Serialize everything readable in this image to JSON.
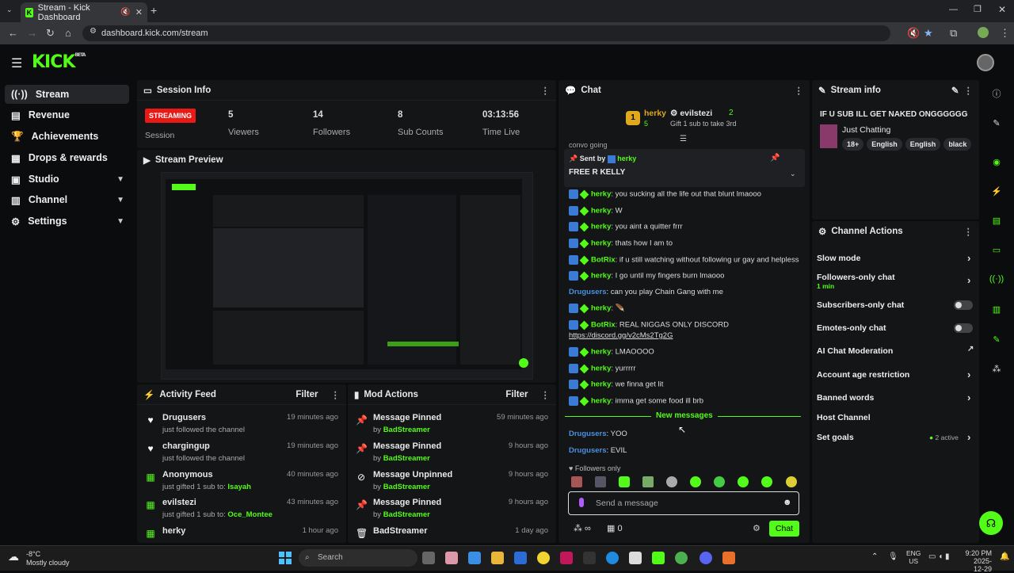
{
  "browser": {
    "tab_title": "Stream - Kick Dashboard",
    "url": "dashboard.kick.com/stream"
  },
  "app": {
    "logo": "KICK",
    "logo_sup": "BETA"
  },
  "sidebar": {
    "items": [
      {
        "label": "Stream",
        "icon": "broadcast-icon"
      },
      {
        "label": "Revenue",
        "icon": "money-icon"
      },
      {
        "label": "Achievements",
        "icon": "trophy-icon"
      },
      {
        "label": "Drops & rewards",
        "icon": "gift-icon"
      },
      {
        "label": "Studio",
        "icon": "studio-icon"
      },
      {
        "label": "Channel",
        "icon": "channel-icon"
      },
      {
        "label": "Settings",
        "icon": "gear-icon"
      }
    ]
  },
  "session": {
    "title": "Session Info",
    "status_badge": "STREAMING",
    "status_label": "Session",
    "viewers_value": "5",
    "viewers_label": "Viewers",
    "followers_value": "14",
    "followers_label": "Followers",
    "subs_value": "8",
    "subs_label": "Sub Counts",
    "time_value": "03:13:56",
    "time_label": "Time Live"
  },
  "preview": {
    "title": "Stream Preview"
  },
  "activity": {
    "title": "Activity Feed",
    "filter": "Filter",
    "rows": [
      {
        "name": "Drugusers",
        "desc": "just followed the channel",
        "extra": "",
        "time": "19 minutes ago"
      },
      {
        "name": "chargingup",
        "desc": "just followed the channel",
        "extra": "",
        "time": "19 minutes ago"
      },
      {
        "name": "Anonymous",
        "desc": "just gifted 1 sub to:",
        "extra": "Isayah",
        "time": "40 minutes ago"
      },
      {
        "name": "evilstezi",
        "desc": "just gifted 1 sub to:",
        "extra": "Oce_Montee",
        "time": "43 minutes ago"
      },
      {
        "name": "herky",
        "desc": "",
        "extra": "",
        "time": "1 hour ago"
      }
    ]
  },
  "mod": {
    "title": "Mod Actions",
    "filter": "Filter",
    "rows": [
      {
        "name": "Message Pinned",
        "by": "by",
        "who": "BadStreamer",
        "time": "59 minutes ago"
      },
      {
        "name": "Message Pinned",
        "by": "by",
        "who": "BadStreamer",
        "time": "9 hours ago"
      },
      {
        "name": "Message Unpinned",
        "by": "by",
        "who": "BadStreamer",
        "time": "9 hours ago"
      },
      {
        "name": "Message Pinned",
        "by": "by",
        "who": "BadStreamer",
        "time": "9 hours ago"
      },
      {
        "name": "BadStreamer",
        "by": "",
        "who": "",
        "time": "1 day ago"
      }
    ]
  },
  "chat": {
    "title": "Chat",
    "gifter1": "herky",
    "gifter1_count": "5",
    "gifter2": "evilstezi",
    "gifter2_count": "2",
    "gift_hint": "Gift 1 sub to take 3rd",
    "partial": "convo going",
    "pinned_by": "Sent by",
    "pinned_user": "herky",
    "pinned_text": "FREE R KELLY",
    "messages": [
      {
        "user": "herky",
        "text": "you sucking all the life out that blunt lmaooo"
      },
      {
        "user": "herky",
        "text": "W"
      },
      {
        "user": "herky",
        "text": "you aint a quitter frrr"
      },
      {
        "user": "herky",
        "text": "thats how I am to"
      },
      {
        "user": "BotRix",
        "text": "if u still watching without following ur gay and helpless"
      },
      {
        "user": "herky",
        "text": "I go until my fingers burn lmaooo"
      },
      {
        "user": "Drugusers",
        "text": "can you play Chain Gang with me"
      },
      {
        "user": "herky",
        "text": ""
      },
      {
        "user": "BotRix",
        "text": "REAL NIGGAS ONLY DISCORD"
      },
      {
        "user": "",
        "text": "https://discord.gg/v2cMs2Tg2G"
      },
      {
        "user": "herky",
        "text": "LMAOOOO"
      },
      {
        "user": "herky",
        "text": "yurrrrr"
      },
      {
        "user": "herky",
        "text": "we finna get lit"
      },
      {
        "user": "herky",
        "text": "imma get some food ill brb"
      }
    ],
    "new_messages": "New messages",
    "new": [
      {
        "user": "Drugusers",
        "text": "YOO"
      },
      {
        "user": "Drugusers",
        "text": "EVIL"
      }
    ],
    "followers_only": "Followers only",
    "placeholder": "Send a message",
    "points": "0",
    "send": "Chat"
  },
  "stream_info": {
    "title": "Stream info",
    "stream_title": "IF U SUB ILL GET NAKED ONGGGGGG",
    "category": "Just Chatting",
    "tags": [
      "18+",
      "English",
      "English",
      "black"
    ]
  },
  "channel_actions": {
    "title": "Channel Actions",
    "slow": "Slow mode",
    "followers": "Followers-only chat",
    "followers_sub": "1 min",
    "subs": "Subscribers-only chat",
    "emotes": "Emotes-only chat",
    "ai": "AI Chat Moderation",
    "age": "Account age restriction",
    "banned": "Banned words",
    "host": "Host Channel",
    "goals": "Set goals",
    "goals_status": "2 active"
  },
  "taskbar": {
    "temp": "-8°C",
    "weather": "Mostly cloudy",
    "search": "Search",
    "lang1": "ENG",
    "lang2": "US",
    "time": "9:20 PM",
    "date": "2025-12-29"
  },
  "colors": {
    "accent": "#53fc18",
    "badge_red": "#e91916"
  }
}
